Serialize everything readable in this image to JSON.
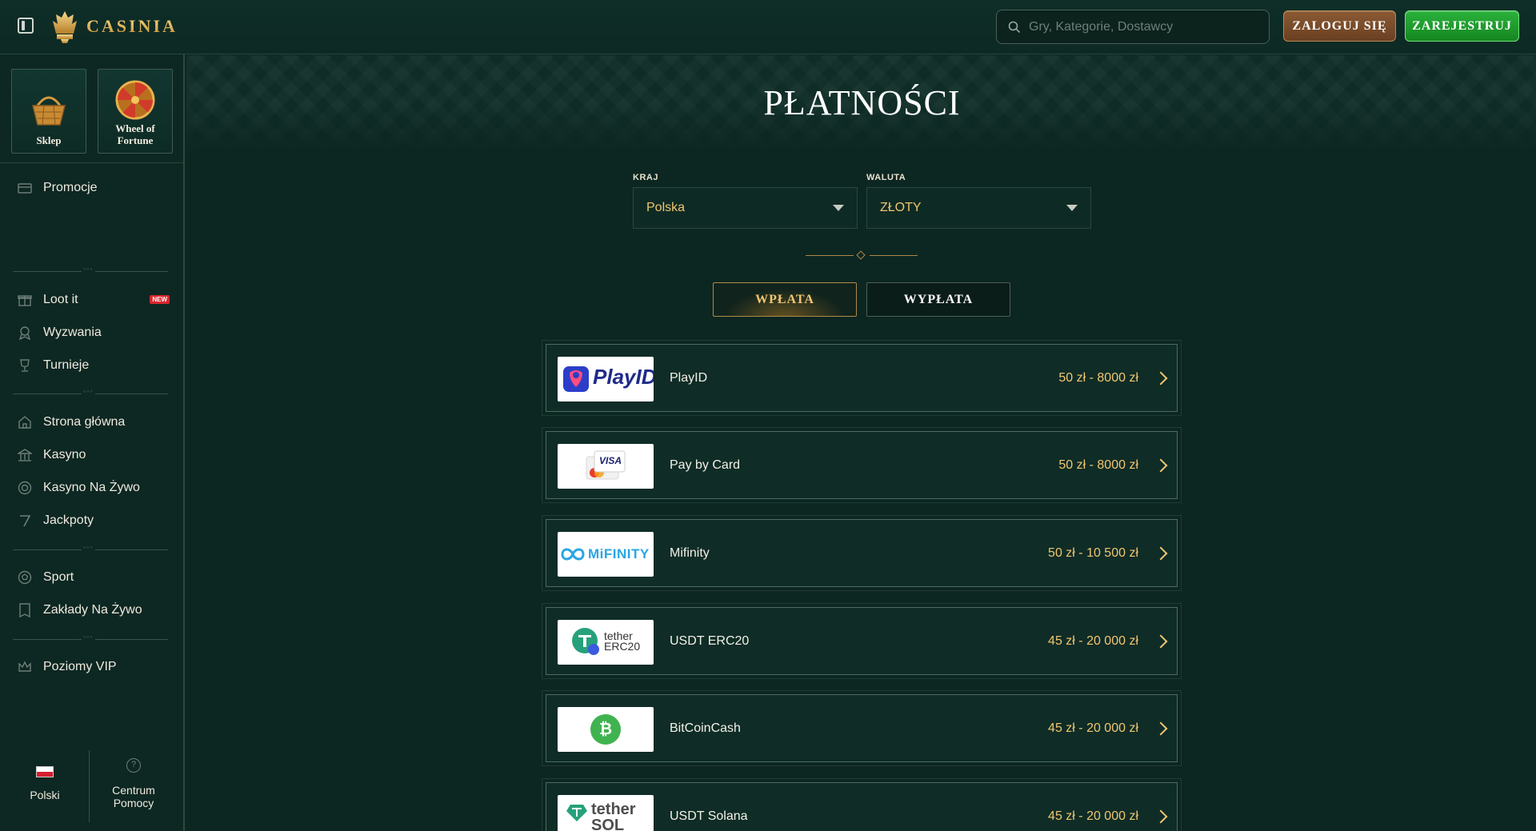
{
  "header": {
    "logo_text": "CASINIA",
    "search_placeholder": "Gry, Kategorie, Dostawcy",
    "login_label": "ZALOGUJ SIĘ",
    "register_label": "ZAREJESTRUJ"
  },
  "sidebar": {
    "tiles": [
      {
        "label": "Sklep",
        "icon": "basket-icon"
      },
      {
        "label": "Wheel of Fortune",
        "icon": "wheel-icon"
      }
    ],
    "groups": [
      [
        {
          "label": "Promocje",
          "icon": "promo-icon"
        }
      ],
      [
        {
          "label": "Loot it",
          "icon": "gift-icon",
          "badge": "NEW"
        },
        {
          "label": "Wyzwania",
          "icon": "challenge-icon"
        },
        {
          "label": "Turnieje",
          "icon": "trophy-icon"
        }
      ],
      [
        {
          "label": "Strona główna",
          "icon": "home-icon"
        },
        {
          "label": "Kasyno",
          "icon": "casino-icon"
        },
        {
          "label": "Kasyno Na Żywo",
          "icon": "live-casino-icon"
        },
        {
          "label": "Jackpoty",
          "icon": "seven-icon"
        }
      ],
      [
        {
          "label": "Sport",
          "icon": "ball-icon"
        },
        {
          "label": "Zakłady Na Żywo",
          "icon": "ticket-icon"
        }
      ],
      [
        {
          "label": "Poziomy VIP",
          "icon": "crown-icon"
        }
      ]
    ],
    "language_label": "Polski",
    "help_label": "Centrum Pomocy"
  },
  "main": {
    "title": "PŁATNOŚCI",
    "country_label": "KRAJ",
    "country_value": "Polska",
    "currency_label": "WALUTA",
    "currency_value": "ZŁOTY",
    "tabs": [
      {
        "label": "WPŁATA",
        "active": true
      },
      {
        "label": "WYPŁATA",
        "active": false
      }
    ],
    "methods": [
      {
        "name": "PlayID",
        "range": "50 zł - 8000 zł",
        "logo": "PlayID"
      },
      {
        "name": "Pay by Card",
        "range": "50 zł - 8000 zł",
        "logo": "VISA"
      },
      {
        "name": "Mifinity",
        "range": "50 zł - 10 500 zł",
        "logo": "MiFINITY"
      },
      {
        "name": "USDT ERC20",
        "range": "45 zł - 20 000 zł",
        "logo": "tether ERC20"
      },
      {
        "name": "BitCoinCash",
        "range": "45 zł - 20 000 zł",
        "logo": "₿"
      },
      {
        "name": "USDT Solana",
        "range": "45 zł - 20 000 zł",
        "logo": "tether SOL"
      }
    ]
  },
  "colors": {
    "accent_gold": "#f1c671",
    "register_green": "#2bb13d",
    "login_brown": "#8a5a33",
    "background": "#0c2621"
  }
}
